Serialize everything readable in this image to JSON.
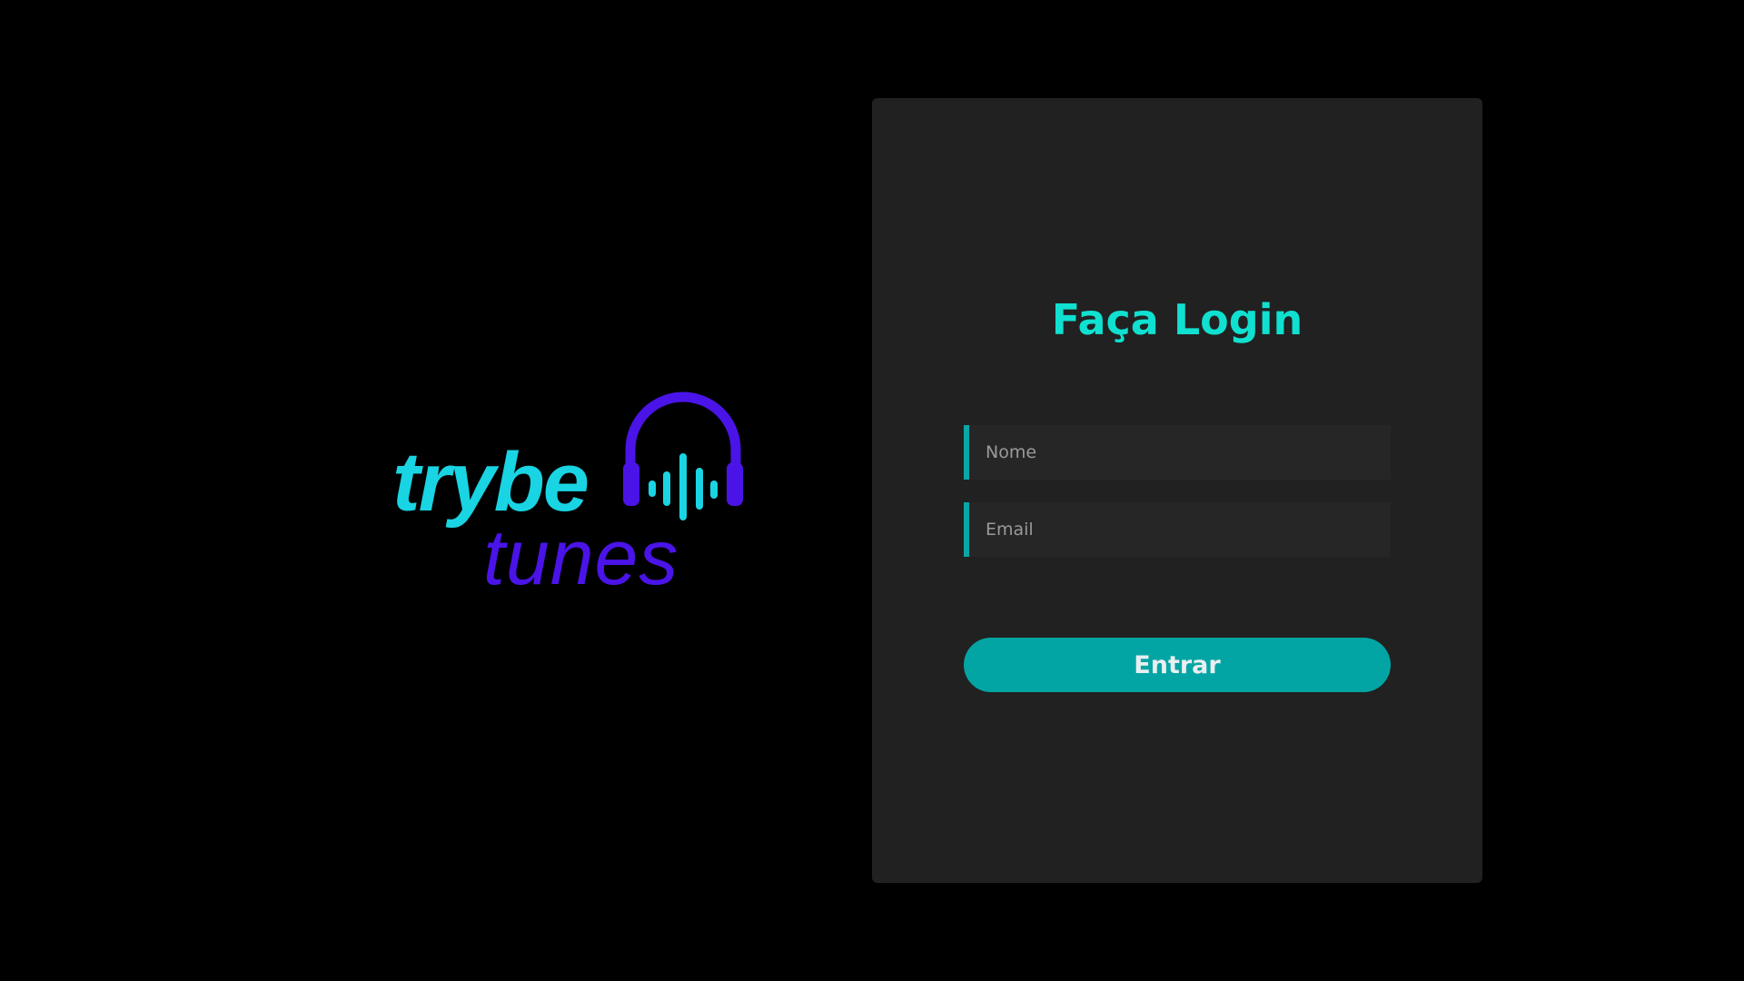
{
  "logo": {
    "line1": "trybe",
    "line2": "tunes",
    "icon": "headphones-soundwave-icon",
    "colors": {
      "primary": "#19d4e3",
      "secondary": "#4a14e8"
    }
  },
  "login": {
    "title": "Faça Login",
    "name_placeholder": "Nome",
    "email_placeholder": "Email",
    "submit_label": "Entrar"
  },
  "theme": {
    "background": "#000000",
    "card": "#212121",
    "accent": "#02a5a3",
    "title": "#10e0d0"
  }
}
